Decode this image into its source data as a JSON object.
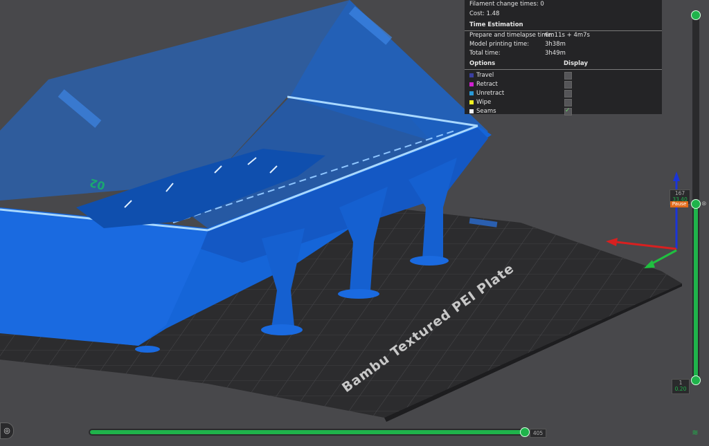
{
  "stats": {
    "filament_change_label": "Filament change times:",
    "filament_change_value": "0",
    "cost_label": "Cost:",
    "cost_value": "1.48",
    "time_estimation_title": "Time Estimation",
    "prepare_label": "Prepare and timelapse time:",
    "prepare_value": "6m11s + 4m7s",
    "model_label": "Model printing time:",
    "model_value": "3h38m",
    "total_label": "Total time:",
    "total_value": "3h49m",
    "options_header": "Options",
    "display_header": "Display",
    "options": [
      {
        "label": "Travel",
        "color": "#3a3fa0",
        "checked": false
      },
      {
        "label": "Retract",
        "color": "#d020d0",
        "checked": false
      },
      {
        "label": "Unretract",
        "color": "#2a9ad8",
        "checked": false
      },
      {
        "label": "Wipe",
        "color": "#f0f020",
        "checked": false
      },
      {
        "label": "Seams",
        "color": "#f2f2f2",
        "checked": true
      }
    ]
  },
  "plate": {
    "name": "Bambu Textured PEI Plate",
    "index_label": "02"
  },
  "vertical_slider": {
    "top_layer": "167",
    "top_height": "33.40",
    "pause_label": "Pause",
    "bottom_layer": "1",
    "bottom_height": "0.20"
  },
  "horizontal_slider": {
    "value": "405",
    "fraction": 0.99
  },
  "colors": {
    "model": "#1565d8",
    "accent": "#1fb34b",
    "plate": "#2c2c2e",
    "background": "#48484b"
  }
}
